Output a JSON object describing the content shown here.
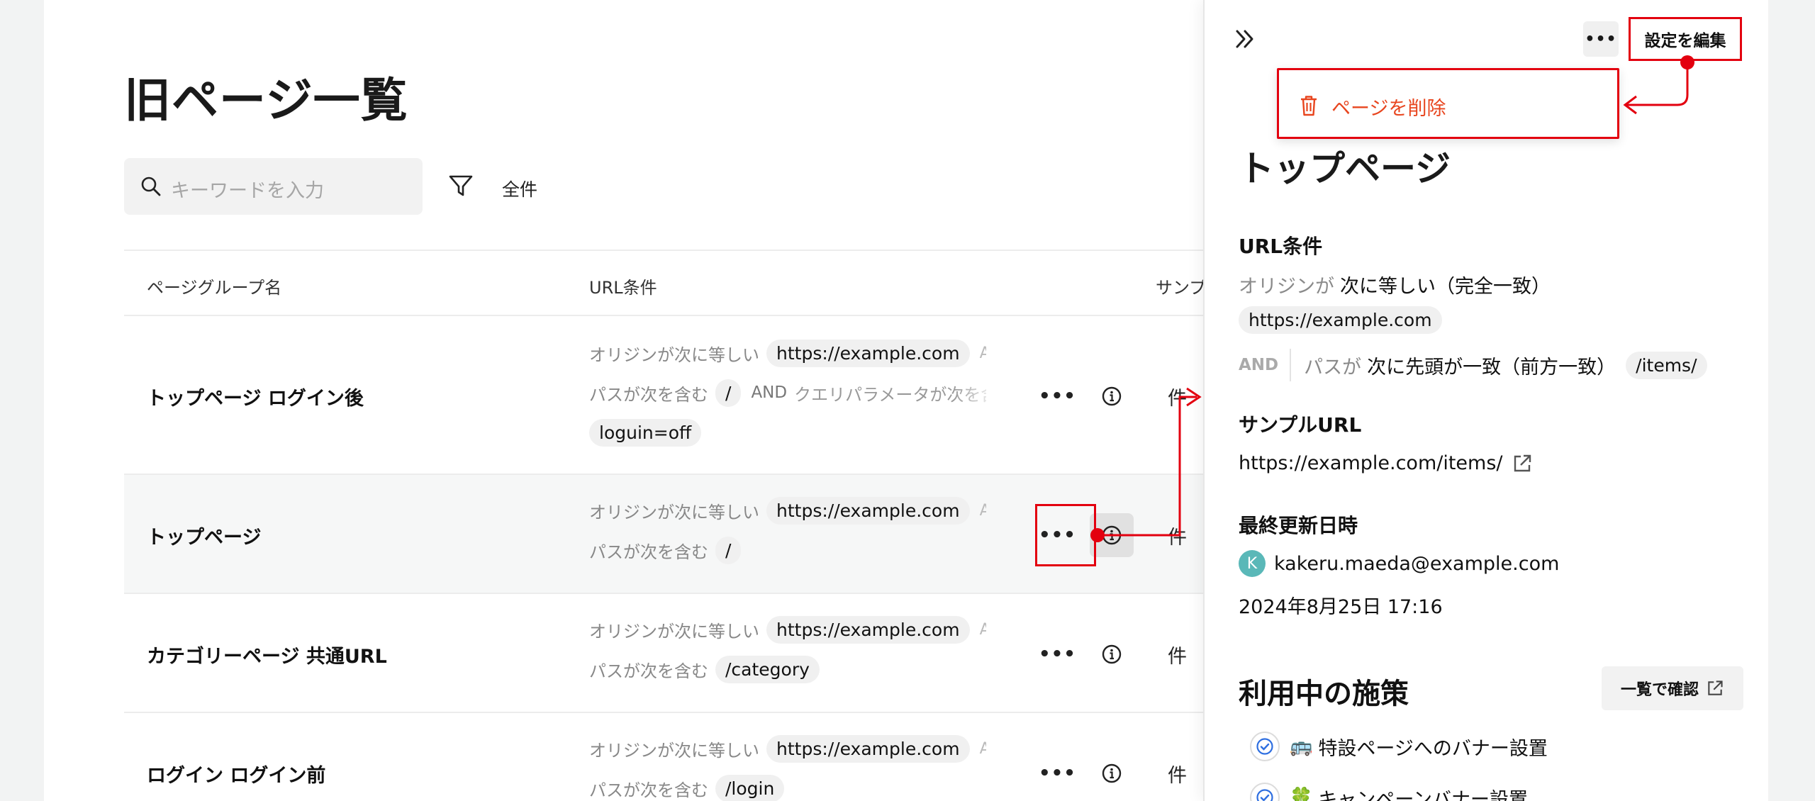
{
  "page": {
    "title": "旧ページ一覧"
  },
  "search": {
    "placeholder": "キーワードを入力"
  },
  "filter": {
    "label": "全件"
  },
  "table": {
    "columns": [
      "ページグループ名",
      "URL条件",
      "サンプルUR"
    ],
    "rows": [
      {
        "name": "トップページ ログイン後",
        "origin_label": "オリジンが次に等しい",
        "origin_value": "https://example.com",
        "and": "AN",
        "path_label": "パスが次を含む",
        "path_value": "/",
        "and2": "AND",
        "query_label": "クエリパラメータが次を含",
        "query_value": "loguin=off",
        "count": "件"
      },
      {
        "name": "トップページ",
        "origin_label": "オリジンが次に等しい",
        "origin_value": "https://example.com",
        "and": "AN",
        "path_label": "パスが次を含む",
        "path_value": "/",
        "count": "件"
      },
      {
        "name": "カテゴリーページ 共通URL",
        "origin_label": "オリジンが次に等しい",
        "origin_value": "https://example.com",
        "and": "AN",
        "path_label": "パスが次を含む",
        "path_value": "/category",
        "count": "件"
      },
      {
        "name": "ログイン ログイン前",
        "origin_label": "オリジンが次に等しい",
        "origin_value": "https://example.com",
        "and": "AN",
        "path_label": "パスが次を含む",
        "path_value": "/login",
        "count": "件"
      }
    ],
    "row_menu": "•••"
  },
  "panel": {
    "more": "•••",
    "edit_button": "設定を編集",
    "menu_delete": "ページを削除",
    "title": "トップページ",
    "url_section": "URL条件",
    "origin_label": "オリジンが",
    "origin_op": "次に等しい（完全一致）",
    "origin_value": "https://example.com",
    "and": "AND",
    "path_label": "パスが",
    "path_op": "次に先頭が一致（前方一致）",
    "path_value": "/items/",
    "sample_section": "サンプルURL",
    "sample_url": "https://example.com/items/",
    "updated_section": "最終更新日時",
    "avatar_letter": "K",
    "updated_by": "kakeru.maeda@example.com",
    "updated_at": "2024年8月25日 17:16",
    "measures_section": "利用中の施策",
    "list_button": "一覧で確認",
    "measures": [
      {
        "emoji": "🚌",
        "label": "特設ページへのバナー設置"
      },
      {
        "emoji": "🍀",
        "label": "キャンペーンバナー設置"
      }
    ]
  },
  "colors": {
    "annotation": "#e3000f",
    "delete": "#e8451e",
    "avatar": "#5ab8b8",
    "check": "#2f6fe0"
  }
}
